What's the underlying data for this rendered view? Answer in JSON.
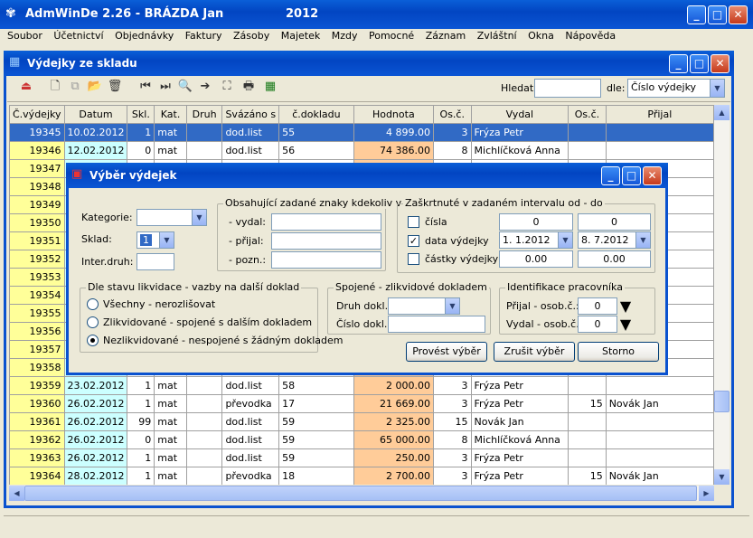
{
  "app": {
    "title": "AdmWinDe 2.26 - BRÁZDA Jan",
    "year": "2012"
  },
  "menu": [
    "Soubor",
    "Účetnictví",
    "Objednávky",
    "Faktury",
    "Zásoby",
    "Majetek",
    "Mzdy",
    "Pomocné",
    "Záznam",
    "Zvláštní",
    "Okna",
    "Nápověda"
  ],
  "child": {
    "title": "Výdejky ze skladu"
  },
  "search": {
    "label": "Hledat:",
    "value": "",
    "by_label": "dle:",
    "by_value": "Číslo výdejky"
  },
  "columns": [
    "Č.výdejky",
    "Datum",
    "Skl.",
    "Kat.",
    "Druh",
    "Svázáno s",
    "č.dokladu",
    "Hodnota",
    "Os.č.",
    "Vydal",
    "Os.č.",
    "Přijal"
  ],
  "rows": [
    [
      "19345",
      "10.02.2012",
      "1",
      "mat",
      "",
      "dod.list",
      "55",
      "4 899.00",
      "3",
      "Frýza Petr",
      "",
      ""
    ],
    [
      "19346",
      "12.02.2012",
      "0",
      "mat",
      "",
      "dod.list",
      "56",
      "74 386.00",
      "8",
      "Michlíčková Anna",
      "",
      ""
    ],
    [
      "19347",
      "",
      "",
      "",
      "",
      "",
      "",
      "",
      "",
      "",
      "",
      ""
    ],
    [
      "19348",
      "",
      "",
      "",
      "",
      "",
      "",
      "",
      "",
      "",
      "",
      ""
    ],
    [
      "19349",
      "",
      "",
      "",
      "",
      "",
      "",
      "",
      "",
      "",
      "",
      ""
    ],
    [
      "19350",
      "",
      "",
      "",
      "",
      "",
      "",
      "",
      "",
      "",
      "",
      ""
    ],
    [
      "19351",
      "",
      "",
      "",
      "",
      "",
      "",
      "",
      "",
      "",
      "",
      ""
    ],
    [
      "19352",
      "",
      "",
      "",
      "",
      "",
      "",
      "",
      "",
      "",
      "",
      ""
    ],
    [
      "19353",
      "",
      "",
      "",
      "",
      "",
      "",
      "",
      "",
      "",
      "",
      ""
    ],
    [
      "19354",
      "",
      "",
      "",
      "",
      "",
      "",
      "",
      "",
      "",
      "",
      ""
    ],
    [
      "19355",
      "",
      "",
      "",
      "",
      "",
      "",
      "",
      "",
      "",
      "",
      ""
    ],
    [
      "19356",
      "",
      "",
      "",
      "",
      "",
      "",
      "",
      "",
      "",
      "",
      ""
    ],
    [
      "19357",
      "",
      "",
      "",
      "",
      "",
      "",
      "",
      "",
      "",
      "",
      ""
    ],
    [
      "19358",
      "",
      "",
      "",
      "",
      "",
      "",
      "",
      "",
      "",
      "",
      ""
    ],
    [
      "19359",
      "23.02.2012",
      "1",
      "mat",
      "",
      "dod.list",
      "58",
      "2 000.00",
      "3",
      "Frýza Petr",
      "",
      ""
    ],
    [
      "19360",
      "26.02.2012",
      "1",
      "mat",
      "",
      "převodka",
      "17",
      "21 669.00",
      "3",
      "Frýza Petr",
      "15",
      "Novák Jan"
    ],
    [
      "19361",
      "26.02.2012",
      "99",
      "mat",
      "",
      "dod.list",
      "59",
      "2 325.00",
      "15",
      "Novák Jan",
      "",
      ""
    ],
    [
      "19362",
      "26.02.2012",
      "0",
      "mat",
      "",
      "dod.list",
      "59",
      "65 000.00",
      "8",
      "Michlíčková Anna",
      "",
      ""
    ],
    [
      "19363",
      "26.02.2012",
      "1",
      "mat",
      "",
      "dod.list",
      "59",
      "250.00",
      "3",
      "Frýza Petr",
      "",
      ""
    ],
    [
      "19364",
      "28.02.2012",
      "1",
      "mat",
      "",
      "převodka",
      "18",
      "2 700.00",
      "3",
      "Frýza Petr",
      "15",
      "Novák Jan"
    ]
  ],
  "dialog": {
    "title": "Výběr výdejek",
    "kategorie_label": "Kategorie:",
    "kategorie_value": "",
    "sklad_label": "Sklad:",
    "sklad_value": "1",
    "inter_label": "Inter.druh:",
    "inter_value": "",
    "grp_text": "Obsahující zadané znaky kdekoliv v",
    "vydal_label": "- vydal:",
    "prijal_label": "- přijal:",
    "pozn_label": "- pozn.:",
    "grp_interval": "Zaškrtnuté v zadaném intervalu od - do",
    "cisla_label": "čísla",
    "cisla_from": "0",
    "cisla_to": "0",
    "data_label": "data výdejky",
    "data_from": "1. 1.2012",
    "data_to": "8. 7.2012",
    "castky_label": "částky výdejky",
    "castky_from": "0.00",
    "castky_to": "0.00",
    "grp_stav": "Dle stavu likvidace - vazby na další doklad",
    "radio1": "Všechny - nerozlišovat",
    "radio2": "Zlikvidované - spojené s dalším dokladem",
    "radio3": "Nezlikvidované - nespojené s žádným dokladem",
    "grp_spojene": "Spojené - zlikvidové dokladem",
    "druh_label": "Druh dokl.:",
    "cislo_label": "Číslo dokl.:",
    "grp_ident": "Identifikace pracovníka",
    "prijal_osob_label": "Přijal - osob.č.:",
    "prijal_osob_value": "0",
    "vydal_osob_label": "Vydal - osob.č.:",
    "vydal_osob_value": "0",
    "btn_provest": "Provést výběr",
    "btn_zrusit": "Zrušit výběr",
    "btn_storno": "Storno"
  }
}
